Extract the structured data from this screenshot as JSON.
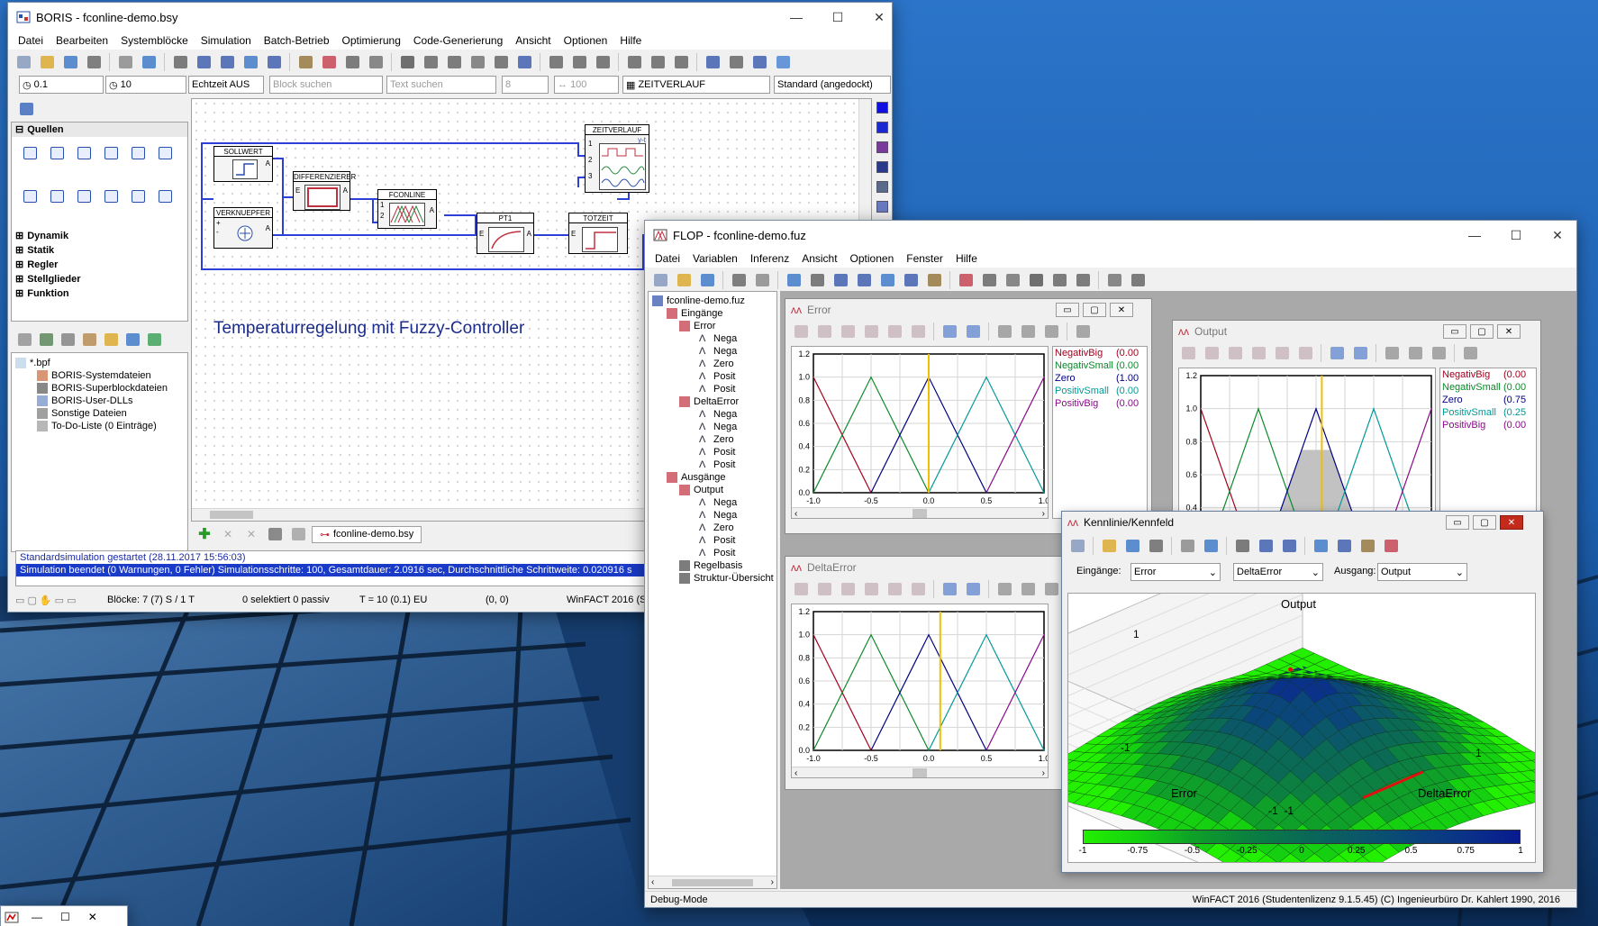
{
  "taskbar": {
    "title": "",
    "minimize": "—",
    "maximize": "☐",
    "close": "✕"
  },
  "boris": {
    "title": "BORIS - fconline-demo.bsy",
    "menu": [
      "Datei",
      "Bearbeiten",
      "Systemblöcke",
      "Simulation",
      "Batch-Betrieb",
      "Optimierung",
      "Code-Generierung",
      "Ansicht",
      "Optionen",
      "Hilfe"
    ],
    "sim_step": "0.1",
    "sim_end": "10",
    "realtime": "Echtzeit AUS",
    "block_search_placeholder": "Block suchen",
    "text_search_placeholder": "Text suchen",
    "font_size": "8",
    "zoom": "100",
    "block_select": "ZEITVERLAUF",
    "docking": "Standard (angedockt)",
    "categories": {
      "quellen": "Quellen",
      "dynamik": "Dynamik",
      "statik": "Statik",
      "regler": "Regler",
      "stellglieder": "Stellglieder",
      "funktion": "Funktion"
    },
    "files": {
      "root": "*.bpf",
      "items": [
        "BORIS-Systemdateien",
        "BORIS-Superblockdateien",
        "BORIS-User-DLLs",
        "Sonstige Dateien",
        "To-Do-Liste (0 Einträge)"
      ]
    },
    "diagram_title": "Temperaturregelung mit Fuzzy-Controller",
    "blocks": {
      "sollwert": "SOLLWERT",
      "verknuepfer": "VERKNUEPFER",
      "differenzierer": "DIFFERENZIERER",
      "fconline": "FCONLINE",
      "pt1": "PT1",
      "totzeit": "TOTZEIT",
      "zeitverlauf": "ZEITVERLAUF"
    },
    "ports": {
      "a": "A",
      "e": "E",
      "one": "1",
      "two": "2",
      "three": "3",
      "plus": "+",
      "minus": "-",
      "yt": "y-t"
    },
    "doc_tab": "fconline-demo.bsy",
    "messages": [
      "Standardsimulation gestartet     (28.11.2017 15:56:03)",
      "Simulation beendet (0 Warnungen, 0 Fehler)     Simulationsschritte: 100, Gesamtdauer:     2.0916 sec, Durchschnittliche Schrittweite:  0.020916 s"
    ],
    "status": {
      "blocks": "Blöcke: 7 (7) S / 1 T",
      "selection": "0 selektiert  0 passiv",
      "time": "T = 10  (0.1)  EU",
      "coords": "(0, 0)",
      "product": "WinFACT 2016 (S"
    }
  },
  "flop": {
    "title": "FLOP - fconline-demo.fuz",
    "menu": [
      "Datei",
      "Variablen",
      "Inferenz",
      "Ansicht",
      "Optionen",
      "Fenster",
      "Hilfe"
    ],
    "tree": {
      "root": "fconline-demo.fuz",
      "inputs": "Eingänge",
      "error": "Error",
      "delta_error": "DeltaError",
      "outputs": "Ausgänge",
      "output": "Output",
      "rulebase": "Regelbasis",
      "structure": "Struktur-Übersicht",
      "terms": [
        "Nega",
        "Nega",
        "Zero",
        "Posit",
        "Posit"
      ]
    },
    "status_left": "Debug-Mode",
    "status_right": "WinFACT 2016 (Studentenlizenz 9.1.5.45)  (C) Ingenieurbüro Dr. Kahlert 1990, 2016",
    "mf_error": {
      "title": "Error",
      "legend": [
        {
          "name": "NegativBig",
          "value": "(0.00",
          "color": "#a3001c"
        },
        {
          "name": "NegativSmall",
          "value": "(0.00",
          "color": "#0a8a2a"
        },
        {
          "name": "Zero",
          "value": "(1.00",
          "color": "#000080"
        },
        {
          "name": "PositivSmall",
          "value": "(0.00",
          "color": "#009999"
        },
        {
          "name": "PositivBig",
          "value": "(0.00",
          "color": "#8a0a8a"
        }
      ]
    },
    "mf_delta": {
      "title": "DeltaError"
    },
    "mf_output": {
      "title": "Output",
      "legend": [
        {
          "name": "NegativBig",
          "value": "(0.00",
          "color": "#a3001c"
        },
        {
          "name": "NegativSmall",
          "value": "(0.00",
          "color": "#0a8a2a"
        },
        {
          "name": "Zero",
          "value": "(0.75",
          "color": "#000080"
        },
        {
          "name": "PositivSmall",
          "value": "(0.25",
          "color": "#009999"
        },
        {
          "name": "PositivBig",
          "value": "(0.00",
          "color": "#8a0a8a"
        }
      ]
    },
    "kennfeld": {
      "title": "Kennlinie/Kennfeld",
      "label_inputs": "Eingänge:",
      "input1": "Error",
      "input2": "DeltaError",
      "label_output": "Ausgang:",
      "output": "Output",
      "axis_z": "Output",
      "axis_x": "Error",
      "axis_y": "DeltaError",
      "tick_z_top": "1",
      "tick_z_bottom": "-1",
      "tick_y_right": "1",
      "tick_bottom": "-1  -1",
      "colorbar_ticks": [
        "-1",
        "-0.75",
        "-0.5",
        "-0.25",
        "0",
        "0.25",
        "0.5",
        "0.75",
        "1"
      ],
      "colorbar_colors": [
        "#22f000",
        "#15d010",
        "#0ea028",
        "#0b8040",
        "#0a6a55",
        "#0a5868",
        "#0a467a",
        "#0a3288",
        "#081a90"
      ]
    }
  },
  "chart_data": [
    {
      "type": "line",
      "title": "Error",
      "xlim": [
        -1,
        1
      ],
      "ylim": [
        0,
        1.2
      ],
      "xticks": [
        "-1.0",
        "-0.5",
        "0.0",
        "0.5",
        "1.0"
      ],
      "yticks": [
        "0.0",
        "0.2",
        "0.4",
        "0.6",
        "0.8",
        "1.0",
        "1.2"
      ],
      "series": [
        {
          "name": "NegativBig",
          "color": "#a3001c",
          "x": [
            -1,
            -0.5
          ],
          "y": [
            1,
            0
          ]
        },
        {
          "name": "NegativSmall",
          "color": "#0a8a2a",
          "x": [
            -1,
            -0.5,
            0
          ],
          "y": [
            0,
            1,
            0
          ]
        },
        {
          "name": "Zero",
          "color": "#000080",
          "x": [
            -0.5,
            0,
            0.5
          ],
          "y": [
            0,
            1,
            0
          ]
        },
        {
          "name": "PositivSmall",
          "color": "#009999",
          "x": [
            0,
            0.5,
            1
          ],
          "y": [
            0,
            1,
            0
          ]
        },
        {
          "name": "PositivBig",
          "color": "#8a0a8a",
          "x": [
            0.5,
            1
          ],
          "y": [
            0,
            1
          ]
        }
      ],
      "marker_x": 0.0
    },
    {
      "type": "line",
      "title": "DeltaError",
      "xlim": [
        -1,
        1
      ],
      "ylim": [
        0,
        1.2
      ],
      "xticks": [
        "-1.0",
        "-0.5",
        "0.0",
        "0.5",
        "1.0"
      ],
      "yticks": [
        "0.0",
        "0.2",
        "0.4",
        "0.6",
        "0.8",
        "1.0",
        "1.2"
      ],
      "series": [
        {
          "color": "#a3001c",
          "x": [
            -1,
            -0.5
          ],
          "y": [
            1,
            0
          ]
        },
        {
          "color": "#0a8a2a",
          "x": [
            -1,
            -0.5,
            0
          ],
          "y": [
            0,
            1,
            0
          ]
        },
        {
          "color": "#000080",
          "x": [
            -0.5,
            0,
            0.5
          ],
          "y": [
            0,
            1,
            0
          ]
        },
        {
          "color": "#009999",
          "x": [
            0,
            0.5,
            1
          ],
          "y": [
            0,
            1,
            0
          ]
        },
        {
          "color": "#8a0a8a",
          "x": [
            0.5,
            1
          ],
          "y": [
            0,
            1
          ]
        }
      ],
      "marker_x": 0.1
    },
    {
      "type": "line",
      "title": "Output",
      "ylim": [
        0,
        1.2
      ],
      "yticks": [
        "0.2",
        "0.4",
        "0.6",
        "0.8",
        "1.0",
        "1.2"
      ],
      "series": [
        {
          "color": "#a3001c",
          "x": [
            -1,
            -0.5
          ],
          "y": [
            1,
            0
          ]
        },
        {
          "color": "#0a8a2a",
          "x": [
            -1,
            -0.5,
            0
          ],
          "y": [
            0,
            1,
            0
          ]
        },
        {
          "color": "#000080",
          "x": [
            -0.5,
            0,
            0.5
          ],
          "y": [
            0,
            1,
            0
          ]
        },
        {
          "color": "#009999",
          "x": [
            0,
            0.5,
            1
          ],
          "y": [
            0,
            1,
            0
          ]
        },
        {
          "color": "#8a0a8a",
          "x": [
            0.5,
            1
          ],
          "y": [
            0,
            1
          ]
        }
      ],
      "area_x": [
        -0.5,
        -0.125,
        0.125,
        0.38,
        0.62,
        0.75,
        1
      ],
      "area_y": [
        0,
        0.75,
        0.75,
        0.24,
        0.24,
        0,
        0
      ],
      "marker_x": 0.05
    }
  ]
}
